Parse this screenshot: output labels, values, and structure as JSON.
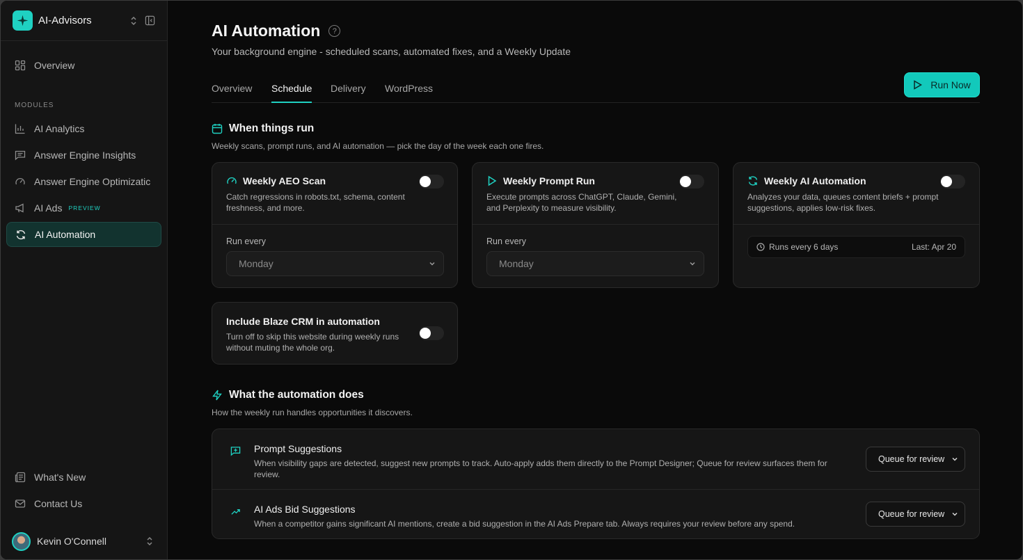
{
  "app": {
    "name": "AI-Advisors"
  },
  "sidebar": {
    "overview_label": "Overview",
    "modules_label": "MODULES",
    "items": [
      {
        "label": "AI Analytics"
      },
      {
        "label": "Answer Engine Insights"
      },
      {
        "label": "Answer Engine Optimizatic"
      },
      {
        "label": "AI Ads",
        "badge": "PREVIEW"
      },
      {
        "label": "AI Automation"
      }
    ],
    "footer": [
      {
        "label": "What's New"
      },
      {
        "label": "Contact Us"
      }
    ],
    "user": {
      "name": "Kevin O'Connell"
    }
  },
  "page": {
    "title": "AI Automation",
    "help_glyph": "?",
    "subtitle": "Your background engine - scheduled scans, automated fixes, and a Weekly Update",
    "tabs": [
      "Overview",
      "Schedule",
      "Delivery",
      "WordPress"
    ],
    "active_tab": "Schedule",
    "run_now_label": "Run Now"
  },
  "schedule": {
    "title": "When things run",
    "subtitle": "Weekly scans, prompt runs, and AI automation — pick the day of the week each one fires.",
    "cards": [
      {
        "title": "Weekly AEO Scan",
        "description": "Catch regressions in robots.txt, schema, content freshness, and more.",
        "enabled": false,
        "run_every_label": "Run every",
        "day": "Monday"
      },
      {
        "title": "Weekly Prompt Run",
        "description": "Execute prompts across ChatGPT, Claude, Gemini, and Perplexity to measure visibility.",
        "enabled": false,
        "run_every_label": "Run every",
        "day": "Monday"
      },
      {
        "title": "Weekly AI Automation",
        "description": "Analyzes your data, queues content briefs + prompt suggestions, applies low-risk fixes.",
        "enabled": false,
        "runs_label": "Runs every 6 days",
        "last_label": "Last: Apr 20"
      }
    ],
    "crm": {
      "title": "Include Blaze CRM in automation",
      "description": "Turn off to skip this website during weekly runs without muting the whole org.",
      "enabled": false
    }
  },
  "automation": {
    "title": "What the automation does",
    "subtitle": "How the weekly run handles opportunities it discovers.",
    "rows": [
      {
        "title": "Prompt Suggestions",
        "description": "When visibility gaps are detected, suggest new prompts to track. Auto-apply adds them directly to the Prompt Designer; Queue for review surfaces them for review.",
        "mode": "Queue for review"
      },
      {
        "title": "AI Ads Bid Suggestions",
        "description": "When a competitor gains significant AI mentions, create a bid suggestion in the AI Ads Prepare tab. Always requires your review before any spend.",
        "mode": "Queue for review"
      }
    ]
  },
  "colors": {
    "accent": "#1fd1c2",
    "background": "#0a0a0a",
    "sidebar": "#151515",
    "card": "#161616"
  }
}
